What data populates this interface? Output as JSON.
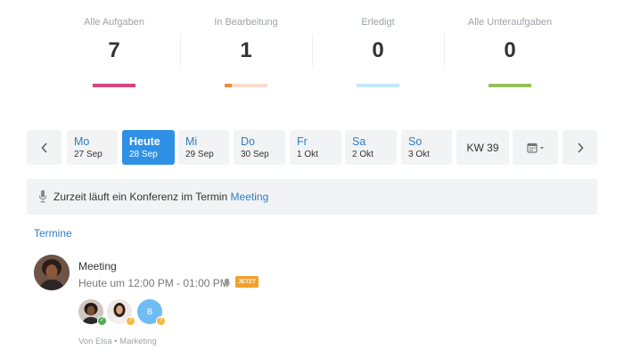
{
  "stats": [
    {
      "label": "Alle Aufgaben",
      "value": "7",
      "color": "#d6457e"
    },
    {
      "label": "In Bearbeitung",
      "value": "1",
      "color": "#ef8c3c"
    },
    {
      "label": "Erledigt",
      "value": "0",
      "color": "#c5e7fa"
    },
    {
      "label": "Alle Unteraufgaben",
      "value": "0",
      "color": "#95c05d"
    }
  ],
  "calendar": {
    "prev_icon": "chevron-left-icon",
    "next_icon": "chevron-right-icon",
    "days": [
      {
        "name": "Mo",
        "date": "27 Sep"
      },
      {
        "name": "Heute",
        "date": "28 Sep",
        "selected": true
      },
      {
        "name": "Mi",
        "date": "29 Sep"
      },
      {
        "name": "Do",
        "date": "30 Sep"
      },
      {
        "name": "Fr",
        "date": "1 Okt"
      },
      {
        "name": "Sa",
        "date": "2 Okt"
      },
      {
        "name": "So",
        "date": "3 Okt"
      }
    ],
    "week_label": "KW 39",
    "picker_icon": "calendar-icon"
  },
  "banner": {
    "icon": "microphone-icon",
    "text": "Zurzeit läuft ein Konferenz im Termin",
    "link": "Meeting"
  },
  "section_title": "Termine",
  "event": {
    "title": "Meeting",
    "time": "Heute um 12:00 PM - 01:00 PM",
    "badge": "JETZT",
    "participant_initial": "B",
    "meta": "Von Elsa • Marketing"
  },
  "colors": {
    "accent": "#2f91e6",
    "link": "#2d7ec7",
    "badge": "#f2a02c"
  }
}
